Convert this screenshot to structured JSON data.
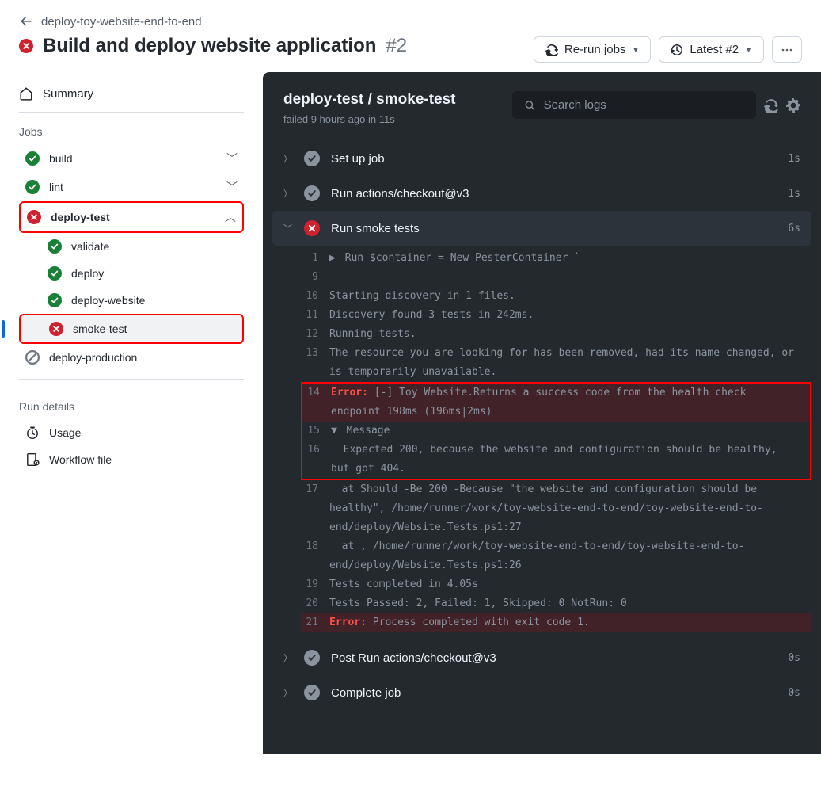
{
  "breadcrumb": "deploy-toy-website-end-to-end",
  "title": "Build and deploy website application",
  "run_number": "#2",
  "buttons": {
    "rerun": "Re-run jobs",
    "latest": "Latest #2"
  },
  "sidebar": {
    "summary": "Summary",
    "jobs_label": "Jobs",
    "jobs": [
      {
        "label": "build",
        "status": "success",
        "expandable": true
      },
      {
        "label": "lint",
        "status": "success",
        "expandable": true
      },
      {
        "label": "deploy-test",
        "status": "fail",
        "expandable": true,
        "expanded": true,
        "highlight": true
      },
      {
        "label": "validate",
        "status": "success",
        "indent": true
      },
      {
        "label": "deploy",
        "status": "success",
        "indent": true
      },
      {
        "label": "deploy-website",
        "status": "success",
        "indent": true
      },
      {
        "label": "smoke-test",
        "status": "fail",
        "indent": true,
        "selected": true,
        "highlight": true
      },
      {
        "label": "deploy-production",
        "status": "skip"
      }
    ],
    "run_details": "Run details",
    "usage": "Usage",
    "workflow_file": "Workflow file"
  },
  "main": {
    "title": "deploy-test / smoke-test",
    "subtitle": "failed 9 hours ago in 11s",
    "search_placeholder": "Search logs",
    "steps": [
      {
        "name": "Set up job",
        "status": "neutral",
        "duration": "1s"
      },
      {
        "name": "Run actions/checkout@v3",
        "status": "neutral",
        "duration": "1s"
      },
      {
        "name": "Run smoke tests",
        "status": "fail",
        "duration": "6s",
        "expanded": true
      },
      {
        "name": "Post Run actions/checkout@v3",
        "status": "neutral",
        "duration": "0s"
      },
      {
        "name": "Complete job",
        "status": "neutral",
        "duration": "0s"
      }
    ],
    "log": [
      {
        "ln": "1",
        "text": "Run $container = New-PesterContainer `",
        "collapsible": "closed"
      },
      {
        "ln": "9",
        "text": ""
      },
      {
        "ln": "10",
        "text": "Starting discovery in 1 files."
      },
      {
        "ln": "11",
        "text": "Discovery found 3 tests in 242ms."
      },
      {
        "ln": "12",
        "text": "Running tests."
      },
      {
        "ln": "13",
        "text": "The resource you are looking for has been removed, had its name changed, or is temporarily unavailable."
      },
      {
        "ln": "14",
        "text": "[-] Toy Website.Returns a success code from the health check endpoint 198ms (196ms|2ms)",
        "error": true,
        "hl": "start"
      },
      {
        "ln": "15",
        "text": "Message",
        "collapsible": "open"
      },
      {
        "ln": "16",
        "text": "  Expected 200, because the website and configuration should be healthy, but got 404.",
        "hl": "end"
      },
      {
        "ln": "17",
        "text": "  at Should -Be 200 -Because \"the website and configuration should be healthy\", /home/runner/work/toy-website-end-to-end/toy-website-end-to-end/deploy/Website.Tests.ps1:27"
      },
      {
        "ln": "18",
        "text": "  at <ScriptBlock>, /home/runner/work/toy-website-end-to-end/toy-website-end-to-end/deploy/Website.Tests.ps1:26"
      },
      {
        "ln": "19",
        "text": "Tests completed in 4.05s"
      },
      {
        "ln": "20",
        "text": "Tests Passed: 2, Failed: 1, Skipped: 0 NotRun: 0"
      },
      {
        "ln": "21",
        "text": "Process completed with exit code 1.",
        "error": true
      }
    ]
  }
}
